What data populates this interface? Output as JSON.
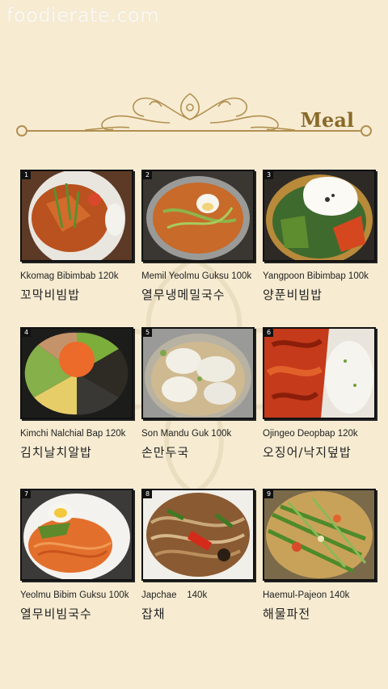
{
  "watermark": "foodierate.com",
  "section": {
    "title": "Meal"
  },
  "items": [
    {
      "num": "1",
      "name": "Kkomag Bibimbab 120k",
      "korean": "꼬막비빔밥"
    },
    {
      "num": "2",
      "name": "Memil Yeolmu Guksu 100k",
      "korean": "열무냉메밀국수"
    },
    {
      "num": "3",
      "name": "Yangpoon Bibimbap 100k",
      "korean": "양푼비빔밥"
    },
    {
      "num": "4",
      "name": "Kimchi Nalchial Bap 120k",
      "korean": "김치날치알밥"
    },
    {
      "num": "5",
      "name": "Son Mandu Guk 100k",
      "korean": "손만두국"
    },
    {
      "num": "6",
      "name": "Ojingeo Deopbap 120k",
      "korean": "오징어/낙지덮밥"
    },
    {
      "num": "7",
      "name": "Yeolmu Bibim Guksu 100k",
      "korean": "열무비빔국수"
    },
    {
      "num": "8",
      "name": "Japchae    140k",
      "korean": "잡채"
    },
    {
      "num": "9",
      "name": "Haemul-Pajeon 140k",
      "korean": "해물파전"
    }
  ],
  "colors": {
    "background": "#f7ecd2",
    "accent_gold": "#b29052",
    "title": "#8a6a2a"
  }
}
